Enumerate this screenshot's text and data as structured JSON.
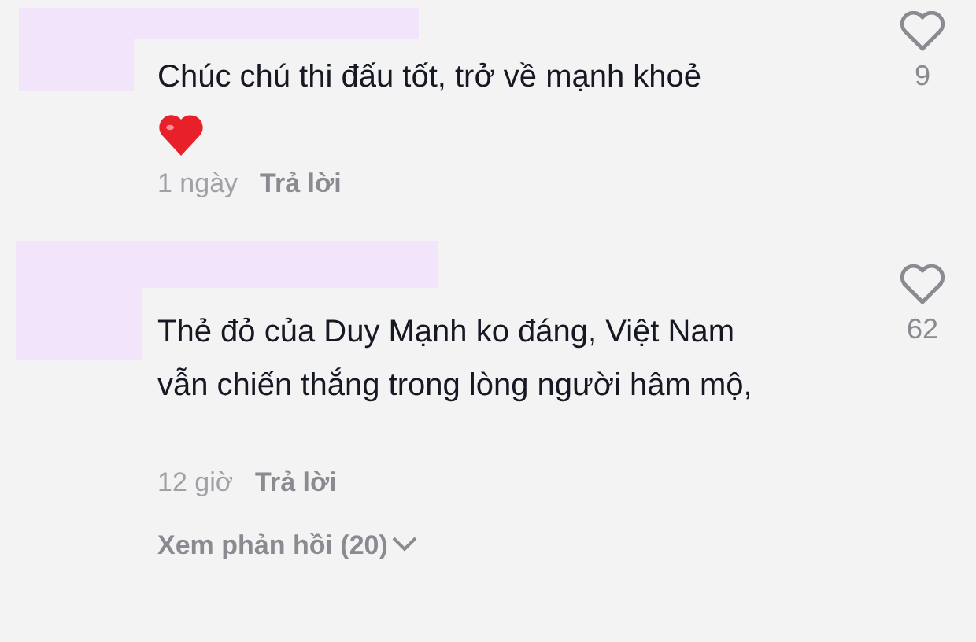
{
  "comments": [
    {
      "text": "Chúc chú thi đấu tốt, trở về mạnh khoẻ",
      "heart_emoji": true,
      "time": "1 ngày",
      "reply": "Trả lời",
      "likes": "9"
    },
    {
      "text": "Thẻ đỏ của Duy Mạnh ko đáng, Việt Nam vẫn chiến thắng trong lòng người hâm mộ,",
      "time": "12 giờ",
      "reply": "Trả lời",
      "likes": "62",
      "view_replies": "Xem phản hồi (20)"
    }
  ]
}
